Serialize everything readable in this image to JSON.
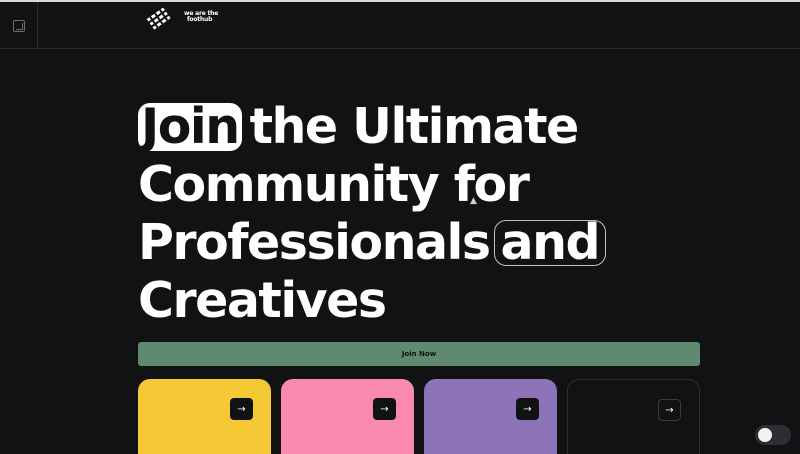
{
  "header": {
    "brand_text_line1": "we are the",
    "brand_text_line2": "foothub"
  },
  "hero": {
    "word_highlight": "Join",
    "line1_rest": "the Ultimate",
    "line2": "Community for",
    "line3_start": "Professionals",
    "word_outline": "and",
    "line4": "Creatives"
  },
  "cta": {
    "join_label": "Join Now"
  },
  "cards": [
    {
      "color": "#f5c935",
      "arrow": "→"
    },
    {
      "color": "#f98aae",
      "arrow": "→"
    },
    {
      "color": "#8d74b8",
      "arrow": "→"
    },
    {
      "color": "#111214",
      "arrow": "→"
    }
  ],
  "colors": {
    "background": "#111214",
    "join_bar": "#5f8a70",
    "accent_white": "#ffffff"
  },
  "icons": {
    "corner": "expand-icon",
    "brand": "brand-logo-icon",
    "arrow": "arrow-right-icon",
    "toggle": "theme-toggle"
  }
}
